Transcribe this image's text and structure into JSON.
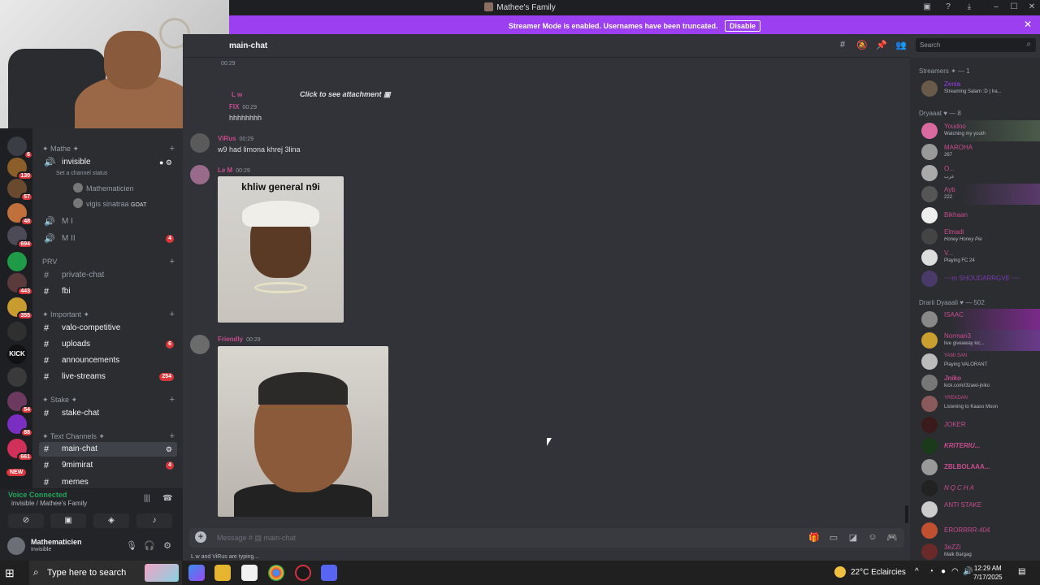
{
  "window": {
    "title": "Mathee's Family"
  },
  "banner": {
    "text": "Streamer Mode is enabled. Usernames have been truncated.",
    "button": "Disable"
  },
  "server": {
    "categories": {
      "mathe": "✦ Mathe ✦",
      "prv": "PRV",
      "important": "✦ Important ✦",
      "stake": "✦ Stake ✦",
      "text": "✦ Text Channels ✦"
    },
    "channels": {
      "invisible": "invisible",
      "invisible_status": "Set a channel status",
      "mi": "M I",
      "mii": "M II",
      "mii_badge": "4",
      "private_chat": "private-chat",
      "fbi": "fbi",
      "valo": "valo-competitive",
      "uploads": "uploads",
      "uploads_badge": "6",
      "announcements": "announcements",
      "live": "live-streams",
      "live_badge": "254",
      "stake_chat": "stake-chat",
      "main_chat": "main-chat",
      "mimirat": "9mimirat",
      "mimirat_badge": "4",
      "memes": "memes"
    },
    "voice_users": {
      "u1": "Mathematicien",
      "u2": "vigis sinatraa",
      "u2_tag": "GOAT"
    }
  },
  "guild_badges": [
    "6",
    "130",
    "57",
    "48",
    "694",
    "443",
    "355",
    "54",
    "88",
    "661",
    "NEW"
  ],
  "voice": {
    "status": "Voice Connected",
    "channel": "invisible / Mathee's Family"
  },
  "user": {
    "name": "Mathematicien",
    "status": "Invisible"
  },
  "chat": {
    "channel": "main-chat",
    "search_placeholder": "Search",
    "messages": {
      "m0_time": "00:29",
      "m1_name": "L w",
      "m1_text": "Click to see attachment",
      "m2_name": "FIX",
      "m2_time": "00:29",
      "m2_text": "hhhhhhhh",
      "m3_name": "ViRus",
      "m3_time": "00:29",
      "m3_text": "w9 had limona khrej 3lina",
      "m4_name": "Le M",
      "m4_time": "00:29",
      "m4_gif_caption": "khliw general n9i",
      "m5_name": "Friendly",
      "m5_time": "00:29"
    },
    "input_placeholder": "Message #",
    "typing": "L w and ViRus are typing..."
  },
  "members": {
    "streamers_header": "Streamers ✦ — 1",
    "dryaaat_header": "Dryaaat ♥ — 8",
    "drarii_header": "Drarii Dyaaali ♥ — 502",
    "list": [
      {
        "n": "Zenia",
        "s": "Streaming Salam :D | Ira..."
      },
      {
        "n": "Youdoo",
        "s": "Watching my youth"
      },
      {
        "n": "MAROHA",
        "s": "267"
      },
      {
        "n": "O...",
        "s": "عرب"
      },
      {
        "n": "Ayb",
        "s": "222"
      },
      {
        "n": "Bikhaan",
        "s": ""
      },
      {
        "n": "Elmadi",
        "s": "Honey Honey Pie"
      },
      {
        "n": "V...",
        "s": "Playing FC 24"
      },
      {
        "n": "~~m SHOUDARRGVE ~~",
        "s": ""
      },
      {
        "n": "ISAAC",
        "s": ""
      },
      {
        "n": "Norman3",
        "s": "live giveaway kic..."
      },
      {
        "n": "YAMI SAN",
        "s": "Playing VALORANT"
      },
      {
        "n": "Jniko",
        "s": "kick.com/i3zawi-jniko"
      },
      {
        "n": "YREKDAN",
        "s": "Listening to Kaaso Moon"
      },
      {
        "n": "JOKER",
        "s": ""
      },
      {
        "n": "KRITERIU...",
        "s": ""
      },
      {
        "n": "ZBLBOLAAA...",
        "s": ""
      },
      {
        "n": "NQCHA",
        "s": ""
      },
      {
        "n": "ANTI STAKE",
        "s": ""
      },
      {
        "n": "ERORRRR-404",
        "s": ""
      },
      {
        "n": "3eZZi",
        "s": "Malk Bargag"
      }
    ]
  },
  "taskbar": {
    "search": "Type here to search",
    "weather": "22°C  Eclaircies",
    "time": "12:29 AM",
    "date": "7/17/2025"
  },
  "colors": {
    "accent": "#9b3ff1",
    "online": "#23a55a",
    "badge": "#da373c"
  }
}
